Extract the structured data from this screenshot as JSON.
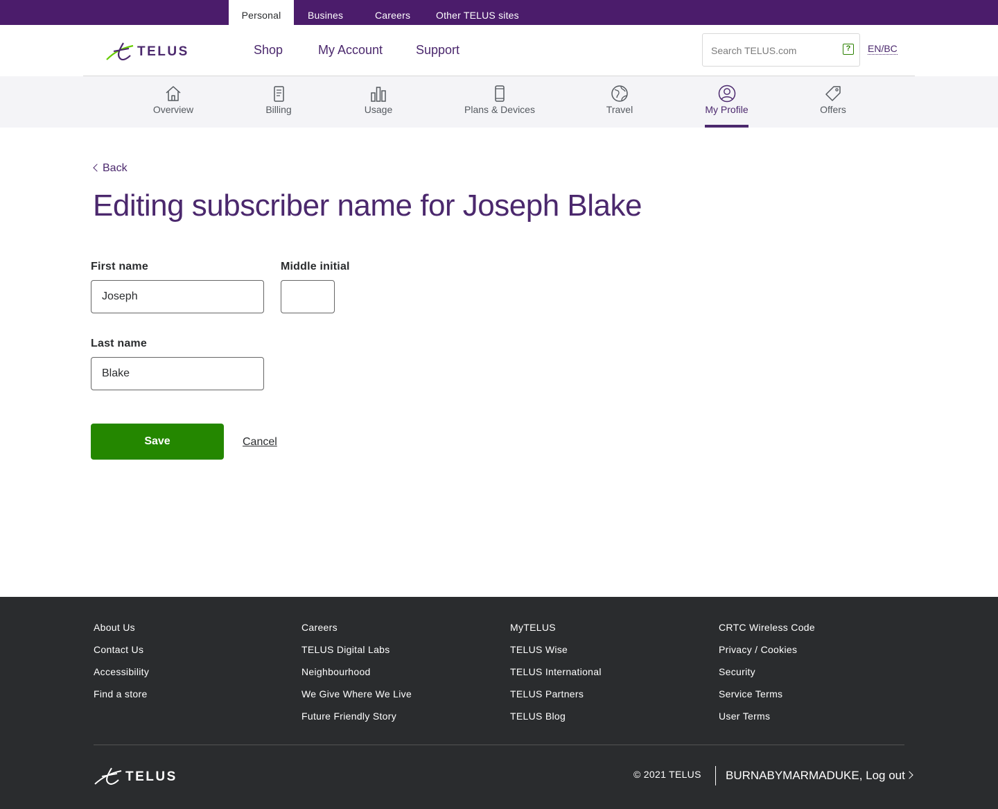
{
  "utility_nav": [
    {
      "label": "Personal",
      "active": true
    },
    {
      "label": "Busines",
      "active": false
    },
    {
      "label": "Careers",
      "active": false
    },
    {
      "label": "Other TELUS sites",
      "active": false
    }
  ],
  "brand": {
    "name": "TELUS",
    "primary_color": "#4b286d",
    "accent_green": "#248700",
    "logo_icon": "telus-logo-icon"
  },
  "main_nav": [
    "Shop",
    "My Account",
    "Support"
  ],
  "search": {
    "placeholder": "Search TELUS.com",
    "value": "",
    "help_icon": "question-mark-icon"
  },
  "language": "EN/BC",
  "sub_nav": [
    {
      "label": "Overview",
      "icon": "house-icon",
      "active": false
    },
    {
      "label": "Billing",
      "icon": "bill-icon",
      "active": false
    },
    {
      "label": "Usage",
      "icon": "bar-chart-icon",
      "active": false
    },
    {
      "label": "Plans & Devices",
      "icon": "mobile-phone-icon",
      "active": false
    },
    {
      "label": "Travel",
      "icon": "globe-icon",
      "active": false
    },
    {
      "label": "My Profile",
      "icon": "user-icon",
      "active": true
    },
    {
      "label": "Offers",
      "icon": "tag-icon",
      "active": false
    }
  ],
  "page": {
    "back_label": "Back",
    "title": "Editing subscriber name for Joseph Blake"
  },
  "form": {
    "first_name": {
      "label": "First name",
      "value": "Joseph"
    },
    "middle_initial": {
      "label": "Middle initial",
      "value": ""
    },
    "last_name": {
      "label": "Last name",
      "value": "Blake"
    },
    "save_label": "Save",
    "cancel_label": "Cancel"
  },
  "footer": {
    "columns": [
      [
        "About Us",
        "Contact Us",
        "Accessibility",
        "Find a store"
      ],
      [
        "Careers",
        "TELUS Digital Labs",
        "Neighbourhood",
        "We Give Where We Live",
        "Future Friendly Story"
      ],
      [
        "MyTELUS",
        "TELUS Wise",
        "TELUS International",
        "TELUS Partners",
        "TELUS Blog"
      ],
      [
        "CRTC Wireless Code",
        "Privacy / Cookies",
        "Security",
        "Service Terms",
        "User Terms"
      ]
    ],
    "copyright": "© 2021 TELUS",
    "logout_label": "BURNABYMARMADUKE, Log out"
  }
}
